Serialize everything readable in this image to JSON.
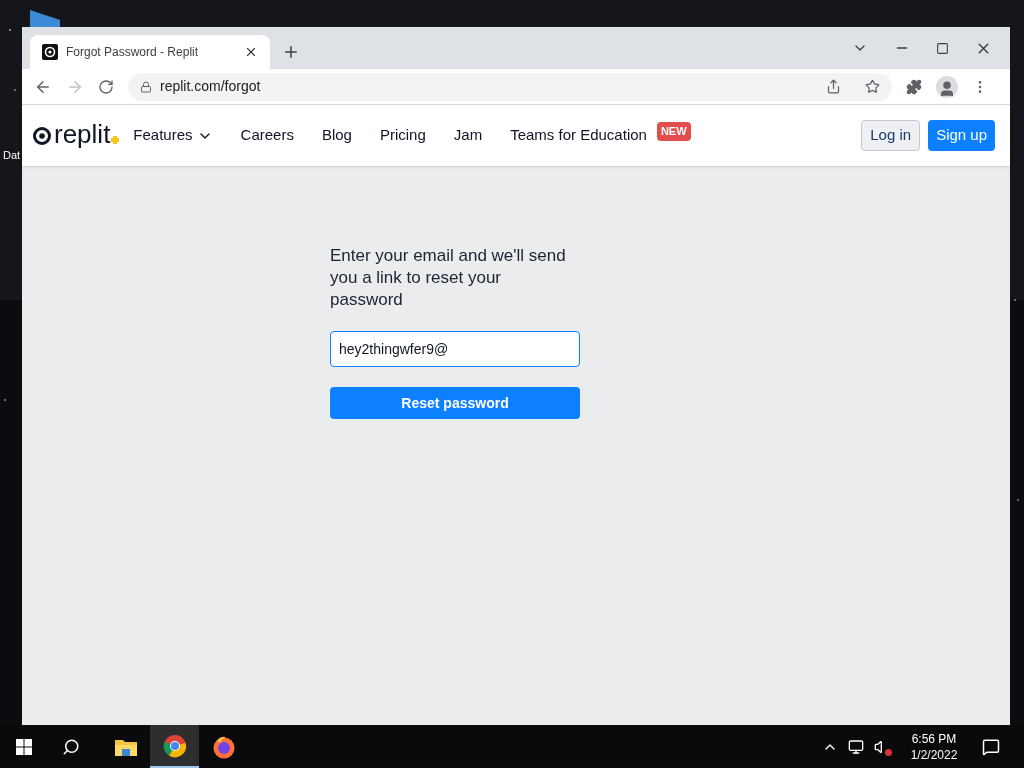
{
  "desktop": {
    "icon_labels": [
      "Dat"
    ]
  },
  "browser": {
    "tab_title": "Forgot Password - Replit",
    "address": "replit.com/forgot"
  },
  "site_nav": {
    "logo": "replit",
    "items": [
      {
        "label": "Features",
        "kind": "dropdown"
      },
      {
        "label": "Careers",
        "kind": "link"
      },
      {
        "label": "Blog",
        "kind": "link"
      },
      {
        "label": "Pricing",
        "kind": "link"
      },
      {
        "label": "Jam",
        "kind": "link"
      },
      {
        "label": "Teams for Education",
        "kind": "link",
        "badge": "NEW"
      }
    ],
    "login": "Log in",
    "signup": "Sign up"
  },
  "form": {
    "prompt": "Enter your email and we'll send you a link to reset your password",
    "email_value": "hey2thingwfer9@",
    "submit": "Reset password"
  },
  "taskbar": {
    "apps": [
      {
        "kind": "files",
        "selected": false
      },
      {
        "kind": "chrome",
        "selected": true
      },
      {
        "kind": "firefox",
        "selected": false
      }
    ],
    "time": "6:56 PM",
    "date": "1/2/2022"
  }
}
